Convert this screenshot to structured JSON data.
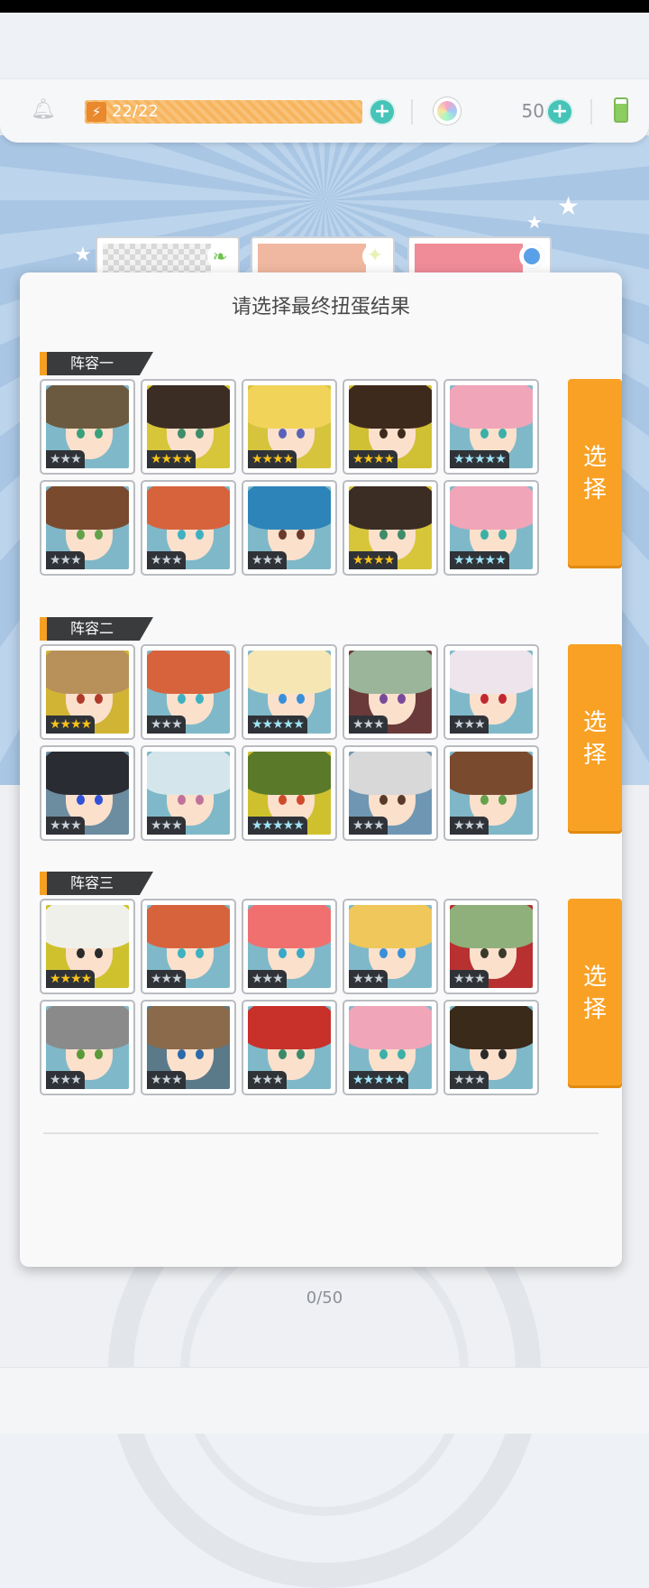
{
  "top_bar": {
    "energy": "22/22",
    "gem_count": "50"
  },
  "dialog": {
    "title": "请选择最终扭蛋结果",
    "select_label_1": "选",
    "select_label_2": "择",
    "teams": [
      {
        "name": "阵容一",
        "characters": [
          {
            "stars": 3,
            "hair": "#6b5a3f",
            "eye": "#3aa07a",
            "bg": "#7fb9c9"
          },
          {
            "stars": 4,
            "hair": "#3b2d24",
            "eye": "#3f8c6a",
            "bg": "#d7c63a"
          },
          {
            "stars": 4,
            "hair": "#f2d35a",
            "eye": "#5a63b8",
            "bg": "#d6c43c"
          },
          {
            "stars": 4,
            "hair": "#3d2a1c",
            "eye": "#3d2a1c",
            "bg": "#d0c034"
          },
          {
            "stars": 5,
            "hair": "#f0a5b8",
            "eye": "#3cb0a8",
            "bg": "#7fb9c9"
          },
          {
            "stars": 3,
            "hair": "#7a4a2e",
            "eye": "#63a24b",
            "bg": "#80b7c8"
          },
          {
            "stars": 3,
            "hair": "#d7633d",
            "eye": "#3fb1c0",
            "bg": "#7fb9c9"
          },
          {
            "stars": 3,
            "hair": "#2d84b8",
            "eye": "#6b3a2a",
            "bg": "#7fb9c9"
          },
          {
            "stars": 4,
            "hair": "#3b2d24",
            "eye": "#3f8c6a",
            "bg": "#d7c63a"
          },
          {
            "stars": 5,
            "hair": "#f0a5b8",
            "eye": "#3cb0a8",
            "bg": "#7fb9c9"
          }
        ]
      },
      {
        "name": "阵容二",
        "characters": [
          {
            "stars": 4,
            "hair": "#b8905a",
            "eye": "#b03a2a",
            "bg": "#d2b434"
          },
          {
            "stars": 3,
            "hair": "#d7633d",
            "eye": "#3fb1c0",
            "bg": "#7fb9c9"
          },
          {
            "stars": 5,
            "hair": "#f6e6b4",
            "eye": "#3a8fd8",
            "bg": "#7fb9c9"
          },
          {
            "stars": 3,
            "hair": "#9ab59a",
            "eye": "#7a4a9a",
            "bg": "#6a3a3a"
          },
          {
            "stars": 3,
            "hair": "#eee4ec",
            "eye": "#c0282f",
            "bg": "#7fb9c9"
          },
          {
            "stars": 3,
            "hair": "#2a2c34",
            "eye": "#2f52d8",
            "bg": "#6c8ca0"
          },
          {
            "stars": 3,
            "hair": "#d4e6ec",
            "eye": "#c0739a",
            "bg": "#7fb9c9"
          },
          {
            "stars": 5,
            "hair": "#5a7a2a",
            "eye": "#d04a2a",
            "bg": "#cfc12e"
          },
          {
            "stars": 3,
            "hair": "#d8d8d8",
            "eye": "#5a3a2a",
            "bg": "#6f97b3"
          },
          {
            "stars": 3,
            "hair": "#7a4a2e",
            "eye": "#63a24b",
            "bg": "#80b7c8"
          }
        ]
      },
      {
        "name": "阵容三",
        "characters": [
          {
            "stars": 4,
            "hair": "#f0f0ea",
            "eye": "#2a2a2a",
            "bg": "#cfc12e"
          },
          {
            "stars": 3,
            "hair": "#d7633d",
            "eye": "#3fb1c0",
            "bg": "#7fb9c9"
          },
          {
            "stars": 3,
            "hair": "#f07070",
            "eye": "#3aa8c8",
            "bg": "#7fb9c9"
          },
          {
            "stars": 3,
            "hair": "#efc75a",
            "eye": "#3a8fd8",
            "bg": "#7fb9c9"
          },
          {
            "stars": 3,
            "hair": "#8fb07a",
            "eye": "#3a3a2a",
            "bg": "#b83030"
          },
          {
            "stars": 3,
            "hair": "#8a8a8a",
            "eye": "#5a9a3a",
            "bg": "#7fb9c9"
          },
          {
            "stars": 3,
            "hair": "#8a6a4a",
            "eye": "#2a6aa8",
            "bg": "#5a7a8a"
          },
          {
            "stars": 3,
            "hair": "#c8302a",
            "eye": "#3a8a6a",
            "bg": "#7fb9c9"
          },
          {
            "stars": 5,
            "hair": "#f0a5b8",
            "eye": "#3cb0a8",
            "bg": "#7fb9c9"
          },
          {
            "stars": 3,
            "hair": "#3a2a1a",
            "eye": "#2a2a2a",
            "bg": "#7fb9c9"
          }
        ]
      }
    ]
  },
  "background": {
    "gacha_count": "0/50"
  }
}
